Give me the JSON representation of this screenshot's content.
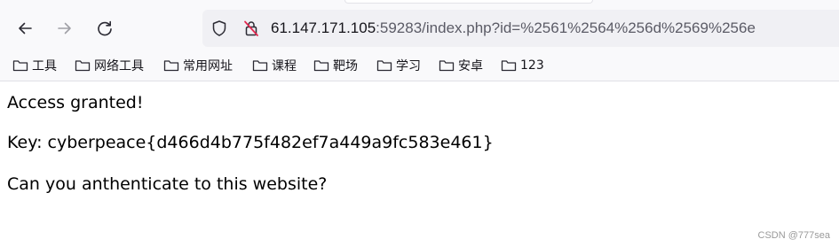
{
  "browser": {
    "url_host": "61.147.171.105",
    "url_rest": ":59283/index.php?id=%2561%2564%256d%2569%256e",
    "icons": {
      "back": "arrow-left-icon",
      "forward": "arrow-right-icon",
      "reload": "reload-icon",
      "tracking": "shield-icon",
      "insecure": "insecure-lock-icon",
      "folder": "folder-icon"
    }
  },
  "bookmarks": [
    {
      "label": "工具"
    },
    {
      "label": "网络工具"
    },
    {
      "label": "常用网址"
    },
    {
      "label": "课程"
    },
    {
      "label": "靶场"
    },
    {
      "label": "学习"
    },
    {
      "label": "安卓"
    },
    {
      "label": "123"
    }
  ],
  "page": {
    "line1": "Access granted!",
    "line2": "Key: cyberpeace{d466d4b775f482ef7a449a9fc583e461}",
    "line3": "Can you anthenticate to this website?"
  },
  "watermark": "CSDN @777sea"
}
